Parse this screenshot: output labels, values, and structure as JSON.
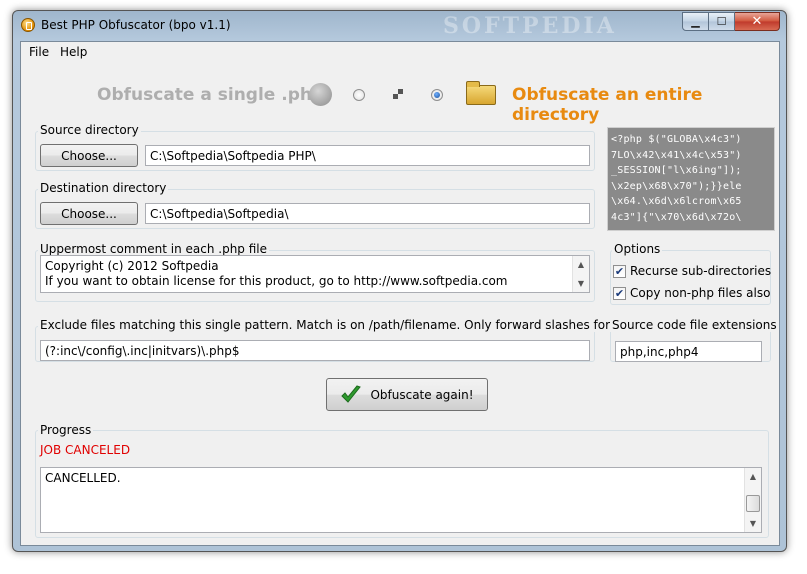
{
  "window": {
    "title": "Best PHP Obfuscator (bpo v1.1)",
    "watermark": "SOFTPEDIA",
    "minimize_glyph": "▁",
    "maximize_glyph": "☐",
    "close_glyph": "✕"
  },
  "menu": {
    "items": [
      "File",
      "Help"
    ]
  },
  "mode": {
    "single_label": "Obfuscate a single .php",
    "directory_label": "Obfuscate an entire directory",
    "selected": "directory"
  },
  "source": {
    "group_label": "Source directory",
    "button_label": "Choose...",
    "path": "C:\\Softpedia\\Softpedia PHP\\"
  },
  "destination": {
    "group_label": "Destination directory",
    "button_label": "Choose...",
    "path": "C:\\Softpedia\\Softpedia\\"
  },
  "code_logo": {
    "lines": [
      "<?php $(\"GLOBA\\x4c3\")",
      "7LO\\x42\\x41\\x4c\\x53\")",
      "_SESSION[\"l\\x6ing\"]);",
      "\\x2ep\\x68\\x70\");}}ele",
      "\\x64.\\x6d\\x6lcrom\\x65",
      "4c3\"]{\"\\x70\\x6d\\x72o\\"
    ]
  },
  "comment": {
    "group_label": "Uppermost comment in each .php file",
    "lines": [
      "Copyright (c) 2012 Softpedia",
      "If you want to obtain license for this product, go to http://www.softpedia.com"
    ]
  },
  "options": {
    "group_label": "Options",
    "recurse_label": "Recurse sub-directories",
    "recurse_checked": true,
    "copy_label": "Copy non-php files also",
    "copy_checked": true,
    "check_glyph": "✔"
  },
  "exclude": {
    "group_label": "Exclude files matching this single pattern. Match is on /path/filename. Only forward slashes for dir sep",
    "pattern": "(?:inc\\/config\\.inc|initvars)\\.php$"
  },
  "extensions": {
    "group_label": "Source code file extensions",
    "value": "php,inc,php4"
  },
  "action": {
    "button_label": "Obfuscate again!"
  },
  "progress": {
    "group_label": "Progress",
    "status": "JOB CANCELED",
    "log": "CANCELLED.",
    "status_color": "#e00000"
  }
}
